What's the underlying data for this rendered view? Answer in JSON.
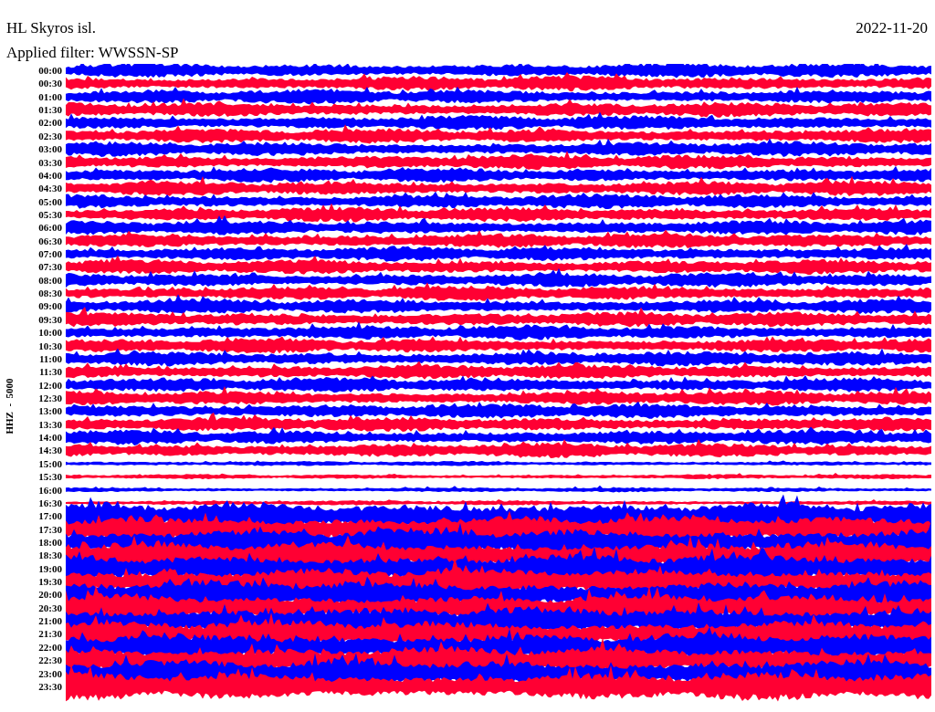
{
  "station": "HL Skyros isl.",
  "date": "2022-11-20",
  "filter": "Applied filter: WWSSN-SP",
  "channel_label": "HHZ  -  5000",
  "rows": [
    {
      "time": "00:00",
      "color": "#0000ff",
      "kind": "moderate"
    },
    {
      "time": "00:30",
      "color": "#ff0033",
      "kind": "moderate"
    },
    {
      "time": "01:00",
      "color": "#0000ff",
      "kind": "moderate"
    },
    {
      "time": "01:30",
      "color": "#ff0033",
      "kind": "moderate"
    },
    {
      "time": "02:00",
      "color": "#0000ff",
      "kind": "moderate"
    },
    {
      "time": "02:30",
      "color": "#ff0033",
      "kind": "moderate"
    },
    {
      "time": "03:00",
      "color": "#0000ff",
      "kind": "moderate"
    },
    {
      "time": "03:30",
      "color": "#ff0033",
      "kind": "moderate"
    },
    {
      "time": "04:00",
      "color": "#0000ff",
      "kind": "moderate"
    },
    {
      "time": "04:30",
      "color": "#ff0033",
      "kind": "moderate"
    },
    {
      "time": "05:00",
      "color": "#0000ff",
      "kind": "moderate"
    },
    {
      "time": "05:30",
      "color": "#ff0033",
      "kind": "moderate"
    },
    {
      "time": "06:00",
      "color": "#0000ff",
      "kind": "moderate"
    },
    {
      "time": "06:30",
      "color": "#ff0033",
      "kind": "moderate"
    },
    {
      "time": "07:00",
      "color": "#0000ff",
      "kind": "moderate"
    },
    {
      "time": "07:30",
      "color": "#ff0033",
      "kind": "moderate"
    },
    {
      "time": "08:00",
      "color": "#0000ff",
      "kind": "moderate"
    },
    {
      "time": "08:30",
      "color": "#ff0033",
      "kind": "moderate"
    },
    {
      "time": "09:00",
      "color": "#0000ff",
      "kind": "moderate"
    },
    {
      "time": "09:30",
      "color": "#ff0033",
      "kind": "moderate"
    },
    {
      "time": "10:00",
      "color": "#0000ff",
      "kind": "moderate"
    },
    {
      "time": "10:30",
      "color": "#ff0033",
      "kind": "moderate"
    },
    {
      "time": "11:00",
      "color": "#0000ff",
      "kind": "moderate"
    },
    {
      "time": "11:30",
      "color": "#ff0033",
      "kind": "moderate"
    },
    {
      "time": "12:00",
      "color": "#0000ff",
      "kind": "moderate"
    },
    {
      "time": "12:30",
      "color": "#ff0033",
      "kind": "moderate"
    },
    {
      "time": "13:00",
      "color": "#0000ff",
      "kind": "moderate"
    },
    {
      "time": "13:30",
      "color": "#ff0033",
      "kind": "moderate"
    },
    {
      "time": "14:00",
      "color": "#0000ff",
      "kind": "moderate"
    },
    {
      "time": "14:30",
      "color": "#ff0033",
      "kind": "moderate"
    },
    {
      "time": "15:00",
      "color": "#0000ff",
      "kind": "quiet"
    },
    {
      "time": "15:30",
      "color": "#ff0033",
      "kind": "quiet"
    },
    {
      "time": "16:00",
      "color": "#0000ff",
      "kind": "quiet"
    },
    {
      "time": "16:30",
      "color": "#ff0033",
      "kind": "quiet"
    },
    {
      "time": "17:00",
      "color": "#0000ff",
      "kind": "strong"
    },
    {
      "time": "17:30",
      "color": "#ff0033",
      "kind": "strong"
    },
    {
      "time": "18:00",
      "color": "#0000ff",
      "kind": "strong"
    },
    {
      "time": "18:30",
      "color": "#ff0033",
      "kind": "strong"
    },
    {
      "time": "19:00",
      "color": "#0000ff",
      "kind": "strong"
    },
    {
      "time": "19:30",
      "color": "#ff0033",
      "kind": "strong"
    },
    {
      "time": "20:00",
      "color": "#0000ff",
      "kind": "strong"
    },
    {
      "time": "20:30",
      "color": "#ff0033",
      "kind": "strong"
    },
    {
      "time": "21:00",
      "color": "#0000ff",
      "kind": "strong"
    },
    {
      "time": "21:30",
      "color": "#ff0033",
      "kind": "strong"
    },
    {
      "time": "22:00",
      "color": "#0000ff",
      "kind": "strong"
    },
    {
      "time": "22:30",
      "color": "#ff0033",
      "kind": "strong"
    },
    {
      "time": "23:00",
      "color": "#0000ff",
      "kind": "strong"
    },
    {
      "time": "23:30",
      "color": "#ff0033",
      "kind": "strong"
    }
  ]
}
